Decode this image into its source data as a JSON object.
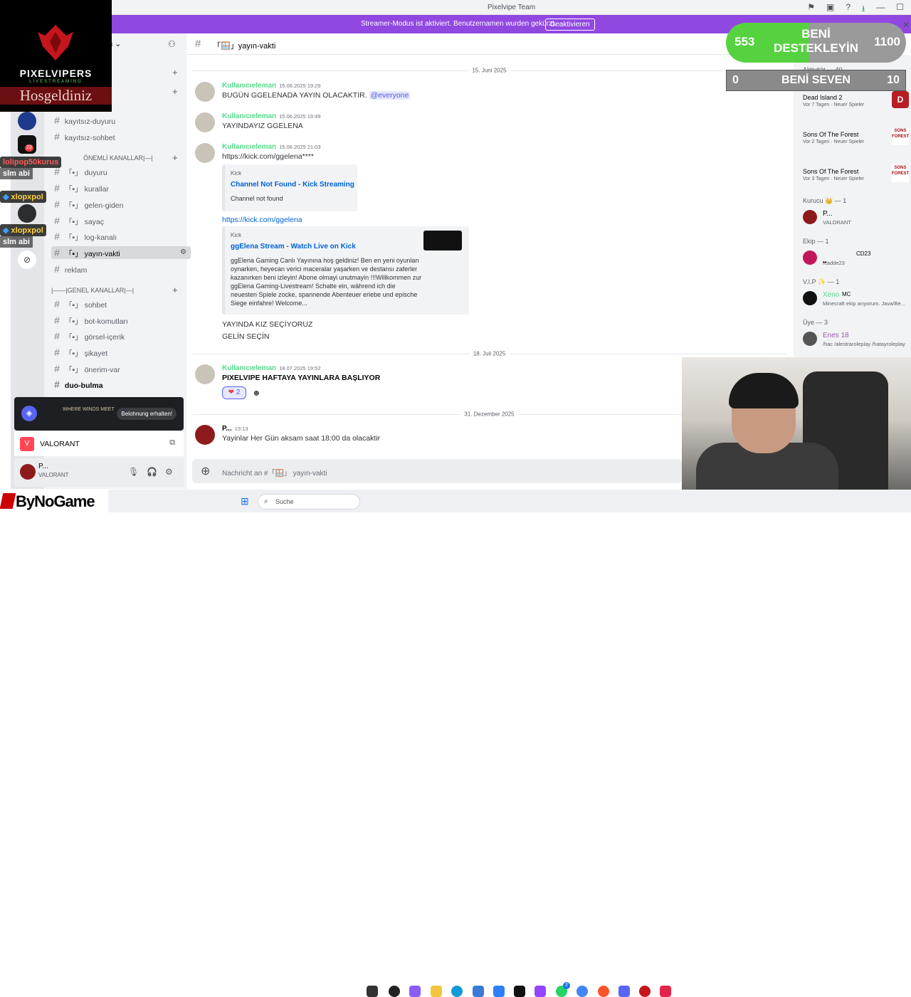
{
  "window": {
    "title": "Pixelvipe Team"
  },
  "streamer_bar": {
    "message": "Streamer-Modus ist aktiviert. Benutzernamen wurden gekürzt.",
    "button": "Deaktivieren"
  },
  "server_name_partial": "n",
  "guild_badge": "23",
  "sidebar": {
    "channels_top": [
      "kayıtsız-duyuru",
      "kayıtsız-sohbet"
    ],
    "category_important": "ÖNEMLİ KANALLAR|—|",
    "important_channels": [
      "duyuru",
      "kurallar",
      "gelen-giden",
      "sayaç",
      "log-kanalı",
      "yayın-vakti",
      "reklam"
    ],
    "category_general": "|——|GENEL KANALLAR|—|",
    "general_channels": [
      "sohbet",
      "bot-komutları",
      "görsel-içerik",
      "şikayet",
      "önerim-var",
      "duo-bulma"
    ],
    "channel_prefix": "「",
    "channel_suffix": "」"
  },
  "promo": {
    "game_wordmark": "WHERE WINDS MEET",
    "button": "Belohnung erhalten!"
  },
  "game_activity": {
    "name": "VALORANT"
  },
  "user_panel": {
    "name": "P...",
    "status": "VALORANT"
  },
  "chat": {
    "channel": "「🪟」yayın-vakti",
    "dividers": [
      "15. Juni 2025",
      "18. Juli 2025",
      "31. Dezember 2025"
    ],
    "messages": [
      {
        "author": "Kullanıcıeleman",
        "time": "15.06.2025 19:29",
        "text": "BUGÜN GGELENADA YAYIN OLACAKTIR.",
        "mention": "@everyone"
      },
      {
        "author": "Kullanıcıeleman",
        "time": "15.06.2025 19:49",
        "text": "YAYINDAYIZ GGELENA"
      },
      {
        "author": "Kullanıcıeleman",
        "time": "15.06.2025 21:03",
        "link1": "https://kick.com/ggelena****",
        "link2": "https://kick.com/ggelena",
        "after1": "YAYINDA KIZ SEÇİYORUZ",
        "after2": "GELİN SEÇİN"
      },
      {
        "author": "Kullanıcıeleman",
        "time": "18.07.2025 19:52",
        "text": "PIXELVIPE HAFTAYA YAYINLARA BAŞLIYOR",
        "reaction_count": "2"
      },
      {
        "author": "P...",
        "time": "13:13",
        "text": "Yayinlar Her Gün aksam saat 18:00 da olacaktir"
      }
    ],
    "embed1": {
      "provider": "Kick",
      "title": "Channel Not Found - Kick Streaming",
      "desc": "Channel not found"
    },
    "embed2": {
      "provider": "Kick",
      "title": "ggElena Stream - Watch Live on Kick",
      "desc": "ggElena Gaming Canlı Yayınına hoş geldiniz! Ben en yeni oyunları oynarken, heyecan verici maceralar yaşarken ve destansı zaferler kazanırken beni izleyin! Abone olmayi unutmayin !!!Willkommen zur ggElena Gaming-Livestream! Schalte ein, während ich die neuesten Spiele zocke, spannende Abenteuer erlebe und epische Siege einfahre! Welcome..."
    },
    "composer_placeholder": "Nachricht an #「🪟」 yayın-vakti"
  },
  "members": {
    "activity_header": "Aktivität — 40",
    "activities": [
      {
        "title": "Dead Island 2",
        "sub": "Vor 7 Tagen · Neuer Spieler",
        "thumb": "D"
      },
      {
        "title": "Sons Of The Forest",
        "sub": "Vor 2 Tagen · Neuer Spieler",
        "thumb": "SONS FOREST"
      },
      {
        "title": "Sons Of The Forest",
        "sub": "Vor 3 Tagen · Neuer Spieler",
        "thumb": "SONS FOREST"
      }
    ],
    "roles": [
      {
        "header": "Kurucu 👑 — 1",
        "name": "P...",
        "status": "VALORANT"
      },
      {
        "header": "Ekip — 1",
        "name": "••",
        "status": "/cadde23",
        "tag": "CD23"
      },
      {
        "header": "V.I.P ✨ — 1",
        "name": "Xeno",
        "tag": "MC",
        "status": "Minecraft ekip arıyorum. Java/Be..."
      },
      {
        "header": "Üye — 3",
        "name": "Enes 18",
        "status": "/hac /alestraroleplay /hatayroleplay"
      }
    ]
  },
  "overlay": {
    "brand": "PIXELVIPERS",
    "brand_sub": "LIVESTREAMING",
    "welcome": "Hosgeldiniz",
    "goal_support": {
      "current": "553",
      "target": "1100",
      "label": "BENİ DESTEKLEYİN",
      "progress": 0.503
    },
    "goal_love": {
      "current": "0",
      "target": "10",
      "label": "BENİ SEVEN",
      "progress": 0
    },
    "chat": [
      {
        "user": "lolipop50kurus",
        "text": "slm abi"
      },
      {
        "user": "xlopxpol",
        "text": ""
      },
      {
        "user": "xlopxpol",
        "text": "slm abi"
      }
    ],
    "sponsor": "ByNoGame"
  },
  "taskbar": {
    "search_placeholder": "Suche",
    "badge_count": "2"
  }
}
